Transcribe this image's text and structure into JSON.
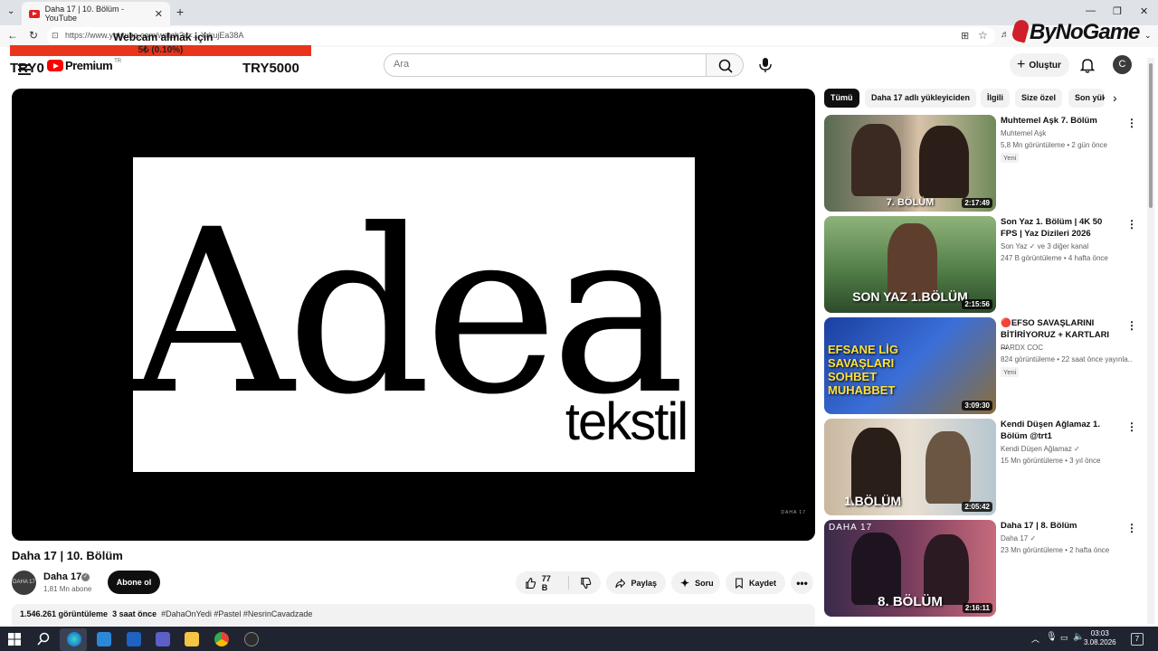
{
  "browser": {
    "tab_title": "Daha 17 | 10. Bölüm - YouTube",
    "new_tab": "+",
    "url": "https://www.youtube.com/watch?v=…YrkujEa38A",
    "min": "—",
    "max": "❐",
    "close": "✕"
  },
  "overlay": {
    "brand": "ByNoGame",
    "webcam_title": "Webcam almak için",
    "progress_text": "5₺ (0.10%)",
    "progress_percent": 0.1,
    "current": "TRY0",
    "goal": "TRY5000"
  },
  "header": {
    "logo_text": "Premium",
    "logo_region": "TR",
    "search_placeholder": "Ara",
    "create_label": "Oluştur",
    "avatar_letter": "C"
  },
  "video": {
    "title": "Daha 17 | 10. Bölüm",
    "brand_word": "Adea",
    "brand_sub": "tekstil",
    "watermark": "DAHA 17",
    "channel": "Daha 17",
    "channel_avatar": "DAHA 17",
    "subs": "1,81 Mn abone",
    "subscribe": "Abone ol",
    "likes": "77 B",
    "share": "Paylaş",
    "ask": "Soru",
    "save": "Kaydet",
    "views": "1.546.261 görüntüleme",
    "age": "3 saat önce",
    "tags": "#DahaOnYedi #Pastel #NesrinCavadzade"
  },
  "chips": [
    "Tümü",
    "Daha 17 adlı yükleyiciden",
    "İlgili",
    "Size özel",
    "Son yük"
  ],
  "recommendations": [
    {
      "title": "Muhtemel Aşk 7. Bölüm",
      "channel": "Muhtemel Aşk",
      "meta": "5,8 Mn görüntüleme • 2 gün önce",
      "badge": "Yeni",
      "duration": "2:17:49",
      "caption": "7. BÖLÜM"
    },
    {
      "title": "Son Yaz 1. Bölüm | 4K 50 FPS | Yaz Dizileri 2026",
      "channel": "Son Yaz ✓ ve 3 diğer kanal",
      "meta": "247 B görüntüleme • 4 hafta önce",
      "badge": "",
      "duration": "2:15:56",
      "caption": "SON YAZ 1.BÖLÜM"
    },
    {
      "title": "🔴EFSO SAVAŞLARINI BİTİRİYORUZ + KARTLARI ...",
      "channel": "PARDX COC",
      "meta": "824 görüntüleme • 22 saat önce yayınla...",
      "badge": "Yeni",
      "duration": "3:09:30",
      "caption": "EFSANE LİG SAVAŞLARI SOHBET MUHABBET"
    },
    {
      "title": "Kendi Düşen Ağlamaz 1. Bölüm @trt1",
      "channel": "Kendi Düşen Ağlamaz ✓",
      "meta": "15 Mn görüntüleme • 3 yıl önce",
      "badge": "",
      "duration": "2:05:42",
      "caption": "1.BÖLÜM"
    },
    {
      "title": "Daha 17 | 8. Bölüm",
      "channel": "Daha 17 ✓",
      "meta": "23 Mn görüntüleme • 2 hafta önce",
      "badge": "",
      "duration": "2:16:11",
      "caption": "8. BÖLÜM"
    }
  ],
  "taskbar": {
    "time": "03:03",
    "date": "3.08.2026",
    "notifications": "7"
  }
}
